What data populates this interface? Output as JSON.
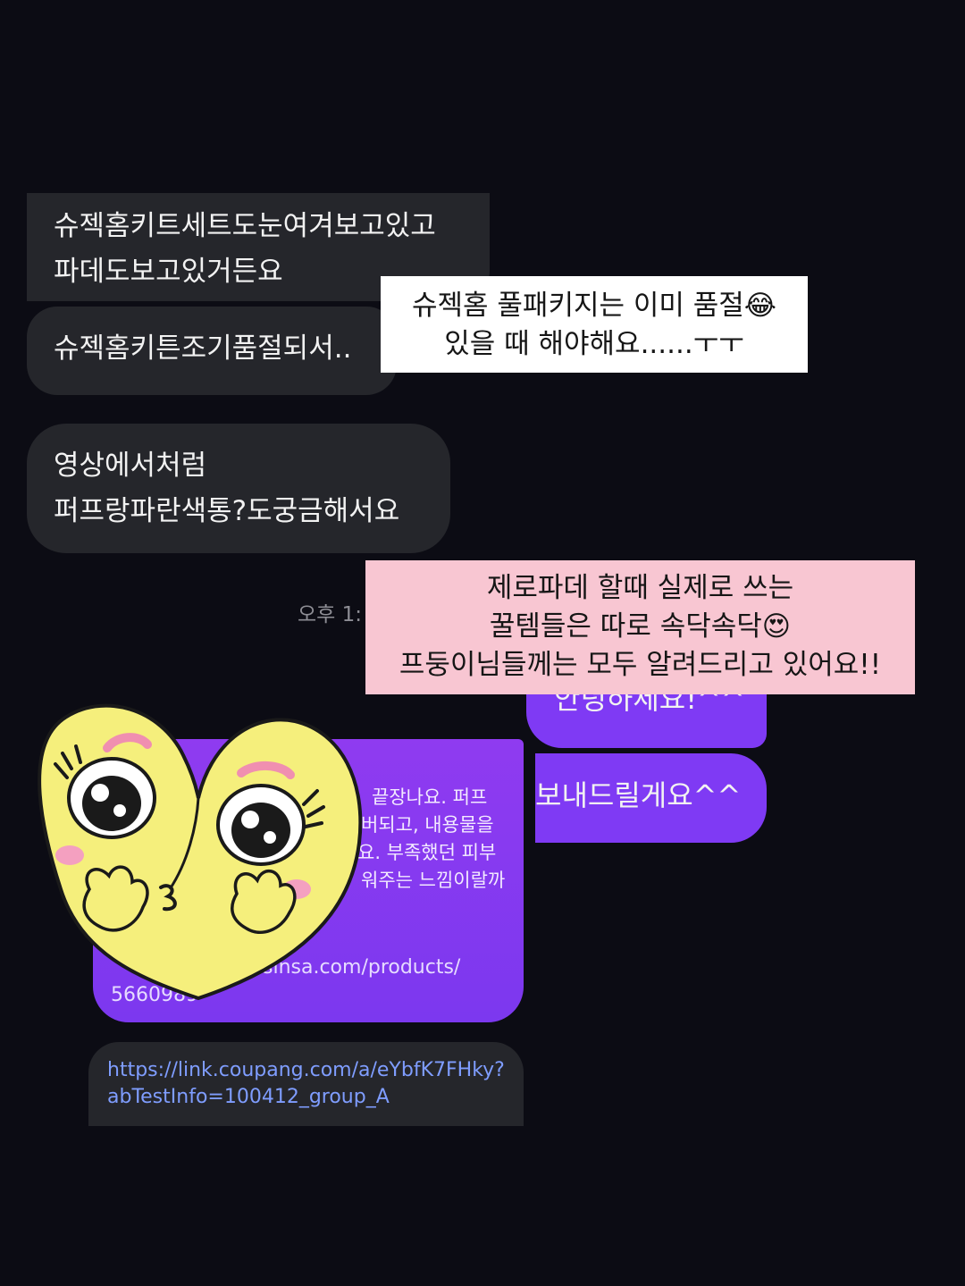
{
  "received": {
    "msg1": {
      "line1": "슈젝홈키트세트도눈여겨보고있고",
      "line2": "파데도보고있거든요"
    },
    "msg2": "슈젝홈키튼조기품절되서..",
    "msg3": {
      "line1": "영상에서처럼",
      "line2": "퍼프랑파란색통?도궁금해서요"
    }
  },
  "timestamp": "오후 1:",
  "sent": {
    "msg1": "안녕하세요!^^",
    "msg2": "보내드릴게요^^"
  },
  "link_card": {
    "line1": "끝장나요. 퍼프",
    "line2": "버되고, 내용물을",
    "line3": "요. 부족했던 피부",
    "line4": "워주는 느낌이랄까",
    "url_line1": "sinsa.com/products/",
    "url_line2": "5660989"
  },
  "coupang_link": {
    "line1": "https://link.coupang.com/a/eYbfK7FHky?",
    "line2": "abTestInfo=100412_group_A"
  },
  "overlay_white": {
    "line1": "슈젝홈 풀패키지는 이미 품절😂",
    "line2": "있을 때 해야해요......ㅜㅜ"
  },
  "overlay_pink": {
    "line1": "제로파데 할때 실제로 쓰는",
    "line2": "꿀템들은 따로 속닥속닥😍",
    "line3": "프둥이님들께는 모두 알려드리고 있어요!!"
  },
  "sticker": {
    "icon": "heart-face-sticker-icon"
  },
  "colors": {
    "background": "#0c0c14",
    "received_bubble": "#25262b",
    "sent_bubble": "#7f3af4",
    "link_text": "#7f9dff",
    "overlay_pink": "#f8c6d2"
  }
}
